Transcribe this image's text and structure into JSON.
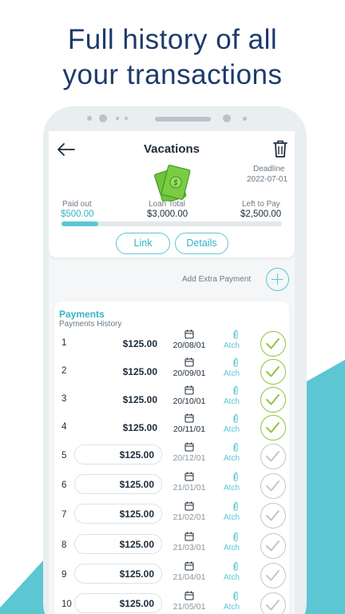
{
  "headline": {
    "line1": "Full history of all",
    "line2": "your transactions"
  },
  "header": {
    "title": "Vacations"
  },
  "deadline": {
    "label": "Deadline",
    "value": "2022-07-01"
  },
  "summary": {
    "paid_out_label": "Paid out",
    "paid_out_value": "$500.00",
    "loan_total_label": "Loan Total",
    "loan_total_value": "$3,000.00",
    "left_label": "Left to Pay",
    "left_value": "$2,500.00",
    "progress_fraction": 0.1667
  },
  "actions": {
    "link_label": "Link",
    "details_label": "Details"
  },
  "extra_payment": {
    "label": "Add Extra Payment"
  },
  "payments": {
    "title": "Payments",
    "subtitle": "Payments History",
    "attach_label": "Atch",
    "rows": [
      {
        "num": "1",
        "amount": "$125.00",
        "date": "20/08/01",
        "paid": true
      },
      {
        "num": "2",
        "amount": "$125.00",
        "date": "20/09/01",
        "paid": true
      },
      {
        "num": "3",
        "amount": "$125.00",
        "date": "20/10/01",
        "paid": true
      },
      {
        "num": "4",
        "amount": "$125.00",
        "date": "20/11/01",
        "paid": true
      },
      {
        "num": "5",
        "amount": "$125.00",
        "date": "20/12/01",
        "paid": false
      },
      {
        "num": "6",
        "amount": "$125.00",
        "date": "21/01/01",
        "paid": false
      },
      {
        "num": "7",
        "amount": "$125.00",
        "date": "21/02/01",
        "paid": false
      },
      {
        "num": "8",
        "amount": "$125.00",
        "date": "21/03/01",
        "paid": false
      },
      {
        "num": "9",
        "amount": "$125.00",
        "date": "21/04/01",
        "paid": false
      },
      {
        "num": "10",
        "amount": "$125.00",
        "date": "21/05/01",
        "paid": false
      }
    ]
  },
  "colors": {
    "accent": "#5cc6d3",
    "accent_text": "#33b4c6",
    "headline": "#1d3a6b",
    "paid_check": "#8cc63f",
    "unpaid_check": "#bfc7cc"
  }
}
